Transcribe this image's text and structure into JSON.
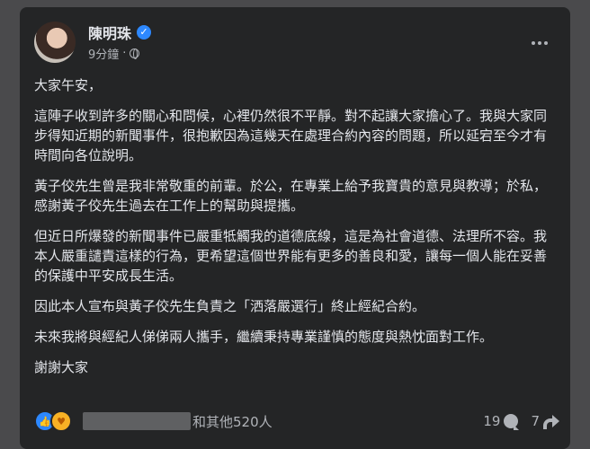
{
  "post": {
    "author": "陳明珠",
    "time": "9分鐘",
    "separator": "·",
    "paragraphs": [
      "大家午安，",
      "這陣子收到許多的關心和問候，心裡仍然很不平靜。對不起讓大家擔心了。我與大家同步得知近期的新聞事件，很抱歉因為這幾天在處理合約內容的問題，所以延宕至今才有時間向各位說明。",
      "黃子佼先生曾是我非常敬重的前輩。於公，在專業上給予我寶貴的意見與教導；於私，感謝黃子佼先生過去在工作上的幫助與提攜。",
      "但近日所爆發的新聞事件已嚴重牴觸我的道德底線，這是為社會道德、法理所不容。我本人嚴重譴責這樣的行為，更希望這個世界能有更多的善良和愛，讓每一個人能在妥善的保護中平安成長生活。",
      "因此本人宣布與黃子佼先生負責之「洒落嚴選行」終止經紀合約。",
      "未來我將與經紀人俤俤兩人攜手，繼續秉持專業謹慎的態度與熱忱面對工作。",
      "謝謝大家"
    ]
  },
  "footer": {
    "reactions_text": "和其他520人",
    "comments_count": "19",
    "shares_count": "7"
  },
  "icons": {
    "verified": "verified-badge-icon",
    "globe": "globe-icon",
    "more": "more-options-icon",
    "like": "like-reaction-icon",
    "care": "care-reaction-icon",
    "comment": "comment-icon",
    "share": "share-icon"
  },
  "colors": {
    "card_bg": "#242526",
    "text": "#e4e6eb",
    "secondary_text": "#b0b3b8",
    "accent": "#2d88ff"
  }
}
